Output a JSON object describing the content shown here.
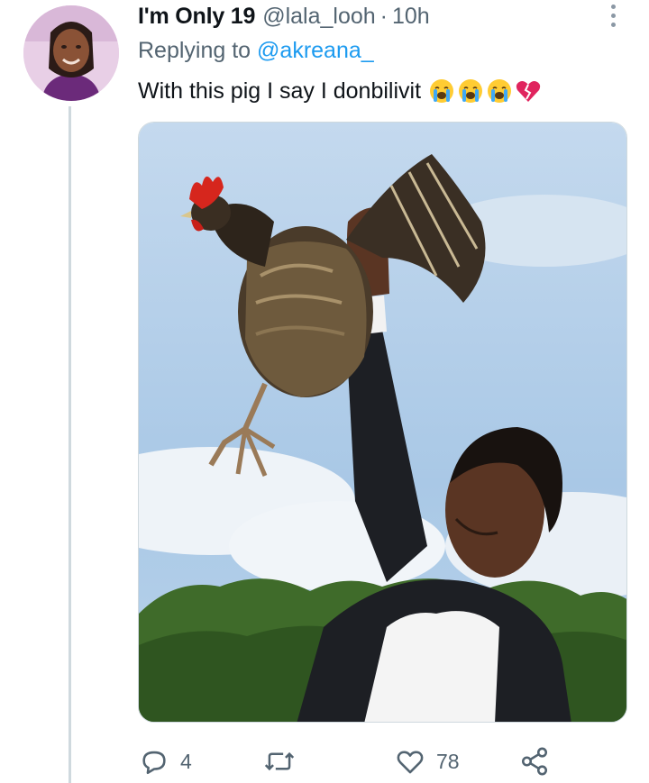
{
  "tweet": {
    "display_name": "I'm Only 19",
    "handle": "@lala_looh",
    "separator": "·",
    "time": "10h",
    "replying_prefix": "Replying to",
    "replying_to": "@akreana_",
    "text": "With this pig I say I donbilivit",
    "emojis": [
      "loudly-crying-face",
      "loudly-crying-face",
      "loudly-crying-face",
      "broken-heart"
    ]
  },
  "actions": {
    "reply_count": "4",
    "retweet_count": "",
    "like_count": "78"
  },
  "colors": {
    "link": "#1d9bf0",
    "secondary_text": "#536471",
    "thread_line": "#cfd9de",
    "icon": "#536471"
  },
  "icons": {
    "reply": "speech-bubble-icon",
    "retweet": "retweet-arrows-icon",
    "like": "heart-icon",
    "share": "share-nodes-icon",
    "more": "vertical-dots-icon"
  }
}
